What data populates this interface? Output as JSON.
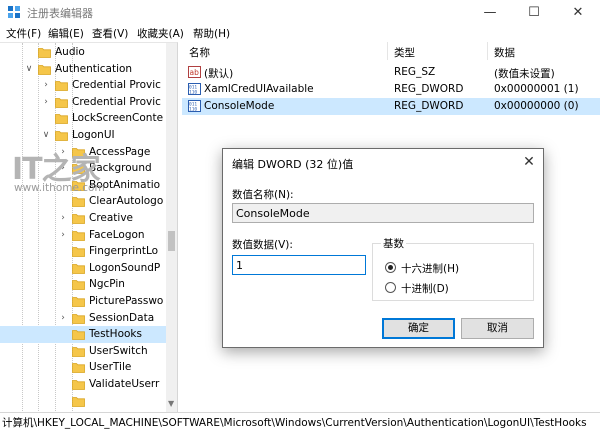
{
  "window": {
    "title": "注册表编辑器",
    "controls": {
      "minimize": "—",
      "maximize": "☐",
      "close": "✕"
    }
  },
  "menu": [
    "文件(F)",
    "编辑(E)",
    "查看(V)",
    "收藏夹(A)",
    "帮助(H)"
  ],
  "tree": {
    "items": [
      {
        "label": "Audio",
        "expander": ""
      },
      {
        "label": "Authentication",
        "expander": "∨"
      },
      {
        "label": "Credential Provic",
        "expander": "›"
      },
      {
        "label": "Credential Provic",
        "expander": "›"
      },
      {
        "label": "LockScreenConte",
        "expander": ""
      },
      {
        "label": "LogonUI",
        "expander": "∨"
      },
      {
        "label": "AccessPage",
        "expander": "›"
      },
      {
        "label": "Background",
        "expander": "›"
      },
      {
        "label": "BootAnimatio",
        "expander": ""
      },
      {
        "label": "ClearAutologo",
        "expander": ""
      },
      {
        "label": "Creative",
        "expander": "›"
      },
      {
        "label": "FaceLogon",
        "expander": "›"
      },
      {
        "label": "FingerprintLo",
        "expander": ""
      },
      {
        "label": "LogonSoundP",
        "expander": ""
      },
      {
        "label": "NgcPin",
        "expander": ""
      },
      {
        "label": "PicturePasswo",
        "expander": ""
      },
      {
        "label": "SessionData",
        "expander": "›"
      },
      {
        "label": "TestHooks",
        "expander": ""
      },
      {
        "label": "UserSwitch",
        "expander": ""
      },
      {
        "label": "UserTile",
        "expander": ""
      },
      {
        "label": "ValidateUserr",
        "expander": ""
      },
      {
        "label": "",
        "expander": ""
      }
    ],
    "selected_item": "TestHooks"
  },
  "columns": {
    "name": "名称",
    "type": "类型",
    "data": "数据"
  },
  "values": [
    {
      "icon": "ab",
      "name": "(默认)",
      "type": "REG_SZ",
      "data": "(数值未设置)"
    },
    {
      "icon": "011",
      "name": "XamlCredUIAvailable",
      "type": "REG_DWORD",
      "data": "0x00000001 (1)"
    },
    {
      "icon": "011",
      "name": "ConsoleMode",
      "type": "REG_DWORD",
      "data": "0x00000000 (0)"
    }
  ],
  "selected_value": "ConsoleMode",
  "statusbar": "计算机\\HKEY_LOCAL_MACHINE\\SOFTWARE\\Microsoft\\Windows\\CurrentVersion\\Authentication\\LogonUI\\TestHooks",
  "dialog": {
    "title": "编辑 DWORD (32 位)值",
    "close": "✕",
    "value_name_label": "数值名称(N):",
    "value_name": "ConsoleMode",
    "value_data_label": "数值数据(V):",
    "value_data": "1",
    "base_label": "基数",
    "base_hex": "十六进制(H)",
    "base_dec": "十进制(D)",
    "base_selected": "hex",
    "ok": "确定",
    "cancel": "取消"
  },
  "watermark": {
    "logo": "IT之家",
    "url": "www.ithome.com"
  },
  "colors": {
    "selection": "#cce8ff",
    "accent": "#0078d7",
    "folder": "#f5c64a"
  }
}
